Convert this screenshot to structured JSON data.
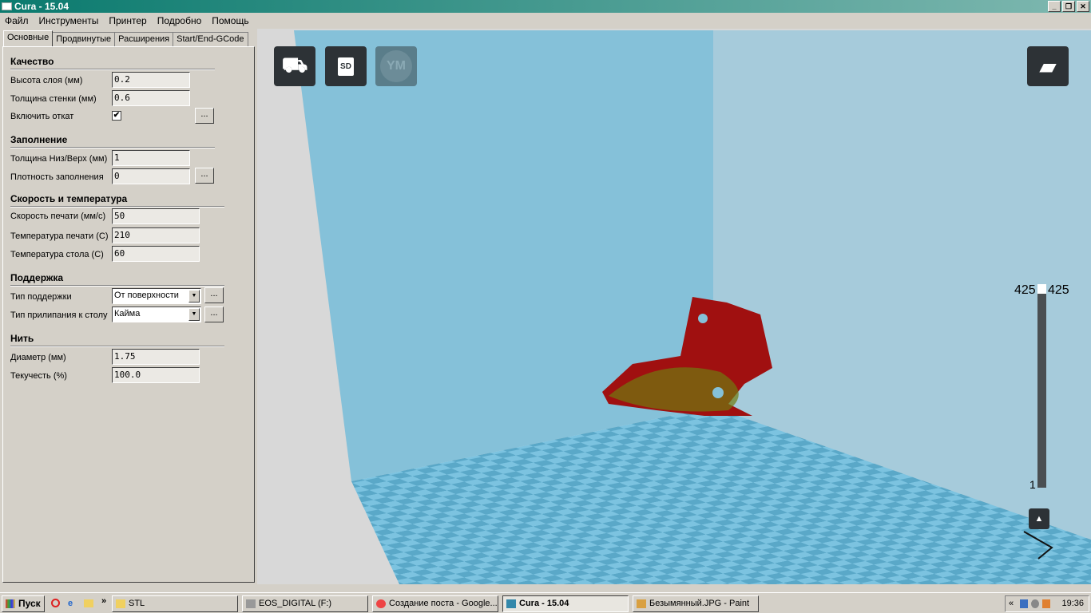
{
  "window": {
    "title": "Cura - 15.04"
  },
  "menu": [
    "Файл",
    "Инструменты",
    "Принтер",
    "Подробно",
    "Помощь"
  ],
  "tabs": [
    "Основные",
    "Продвинутые",
    "Расширения",
    "Start/End-GCode"
  ],
  "sections": {
    "quality": {
      "title": "Качество",
      "layer_height_label": "Высота слоя (мм)",
      "layer_height": "0.2",
      "wall_label": "Толщина стенки (мм)",
      "wall": "0.6",
      "retraction_label": "Включить откат",
      "retraction_checked": true,
      "check_mark": "✔"
    },
    "fill": {
      "title": "Заполнение",
      "bottom_top_label": "Толщина Низ/Верх (мм)",
      "bottom_top": "1",
      "density_label": "Плотность заполнения",
      "density": "0"
    },
    "speed": {
      "title": "Скорость и температура",
      "print_speed_label": "Скорость печати (мм/с)",
      "print_speed": "50",
      "print_temp_label": "Температура печати (С)",
      "print_temp": "210",
      "bed_temp_label": "Температура стола (С)",
      "bed_temp": "60"
    },
    "support": {
      "title": "Поддержка",
      "type_label": "Тип поддержки",
      "type": "От поверхности",
      "adhesion_label": "Тип прилипания к столу",
      "adhesion": "Кайма"
    },
    "filament": {
      "title": "Нить",
      "diameter_label": "Диаметр (мм)",
      "diameter": "1.75",
      "flow_label": "Текучесть (%)",
      "flow": "100.0"
    }
  },
  "ellipsis": "...",
  "viewport": {
    "sd_label": "SD",
    "ym_label": "YM",
    "layer_top_left": "425",
    "layer_top_right": "425",
    "layer_bottom": "1",
    "layer_level": 1.0,
    "colors": {
      "back_wall": "#85c1d9",
      "right_wall": "#a6cbdb",
      "floor_a": "#7cc3e0",
      "floor_b": "#5aa8c8",
      "model": "#a01010"
    }
  },
  "taskbar": {
    "start": "Пуск",
    "chevron": "»",
    "items": [
      "STL",
      "EOS_DIGITAL (F:)",
      "Создание поста - Google...",
      "Cura - 15.04",
      "Безымянный.JPG - Paint"
    ],
    "active": 3,
    "tray_chevron": "«",
    "clock": "19:36"
  }
}
